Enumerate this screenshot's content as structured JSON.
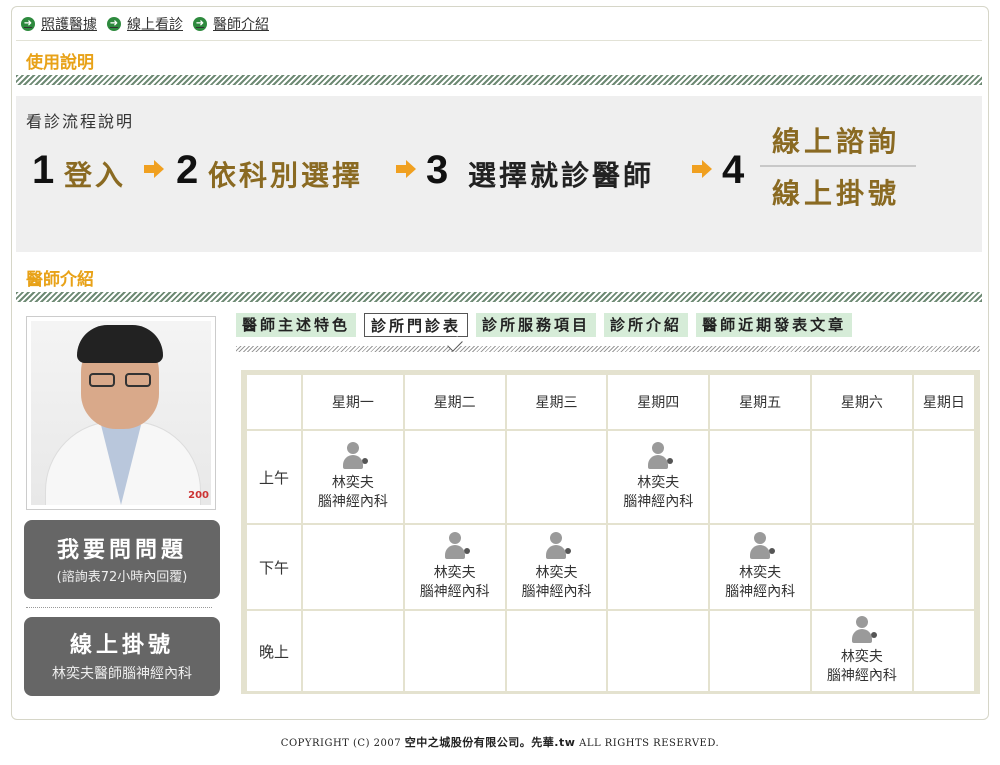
{
  "breadcrumb": [
    {
      "label": "照護醫據"
    },
    {
      "label": "線上看診"
    },
    {
      "label": "醫師介紹"
    }
  ],
  "sections": {
    "usage": "使用說明",
    "doctor": "醫師介紹"
  },
  "flow": {
    "title": "看診流程說明",
    "steps": [
      {
        "num": "1",
        "label": "登入"
      },
      {
        "num": "2",
        "label": "依科別選擇"
      },
      {
        "num": "3",
        "label": "選擇就診醫師"
      },
      {
        "num": "4"
      }
    ],
    "final_options": [
      "線上諮詢",
      "線上掛號"
    ]
  },
  "photo": {
    "tag": "200"
  },
  "ask_button": {
    "title": "我要問問題",
    "subtitle": "(諮詢表72小時內回覆)"
  },
  "register_button": {
    "title": "線上掛號",
    "subtitle": "林奕夫醫師腦神經內科"
  },
  "tabs": [
    {
      "label": "醫師主述特色",
      "active": false
    },
    {
      "label": "診所門診表",
      "active": true
    },
    {
      "label": "診所服務項目",
      "active": false
    },
    {
      "label": "診所介紹",
      "active": false
    },
    {
      "label": "醫師近期發表文章",
      "active": false
    }
  ],
  "schedule": {
    "days": [
      "星期一",
      "星期二",
      "星期三",
      "星期四",
      "星期五",
      "星期六",
      "星期日"
    ],
    "periods": [
      {
        "label": "上午",
        "slots": [
          true,
          false,
          false,
          true,
          false,
          false,
          false
        ]
      },
      {
        "label": "下午",
        "slots": [
          false,
          true,
          true,
          false,
          true,
          false,
          false
        ]
      },
      {
        "label": "晚上",
        "slots": [
          false,
          false,
          false,
          false,
          false,
          true,
          false
        ]
      }
    ],
    "doctor_name": "林奕夫",
    "department": "腦神經內科"
  },
  "footer": {
    "prefix": "COPYRIGHT (C) 2007",
    "company": "空中之城股份有限公司。先華.tw",
    "suffix": "ALL RIGHTS RESERVED."
  },
  "colors": {
    "accent": "#e8a218",
    "step_text": "#8a6a22",
    "tab_bg": "#d6ecd8",
    "button_bg": "#666666"
  }
}
